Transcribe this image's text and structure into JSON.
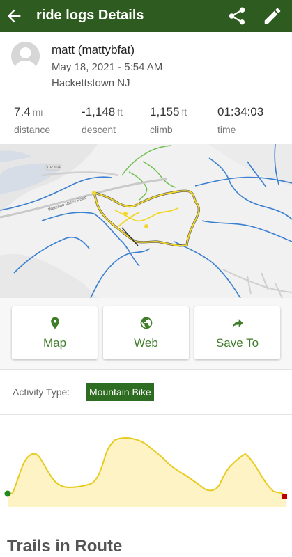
{
  "app_bar": {
    "title": "ride logs Details",
    "background": "#2e5b1f"
  },
  "ride": {
    "user": "matt (mattybfat)",
    "date": "May 18, 2021 - 5:54 AM",
    "location": "Hackettstown NJ"
  },
  "stats": [
    {
      "value": "7.4",
      "unit": "mi",
      "label": "distance"
    },
    {
      "value": "-1,148",
      "unit": "ft",
      "label": "descent"
    },
    {
      "value": "1,155",
      "unit": "ft",
      "label": "climb"
    },
    {
      "value": "01:34:03",
      "unit": "",
      "label": "time"
    }
  ],
  "map": {
    "road_label": "Waterloo Valley Road",
    "road_shield": "CR 604"
  },
  "actions": [
    {
      "label": "Map",
      "icon": "location-pin-icon"
    },
    {
      "label": "Web",
      "icon": "globe-icon"
    },
    {
      "label": "Save To",
      "icon": "share-arrow-icon"
    }
  ],
  "activity": {
    "label": "Activity Type:",
    "value": "Mountain Bike"
  },
  "section_title": "Trails in Route",
  "colors": {
    "accent": "#3f7d2a",
    "route": "#f1d72a",
    "elevation_fill": "#fdf3c4",
    "elevation_line": "#e8cb1f",
    "start": "#1e8a1e",
    "end": "#c00000"
  }
}
